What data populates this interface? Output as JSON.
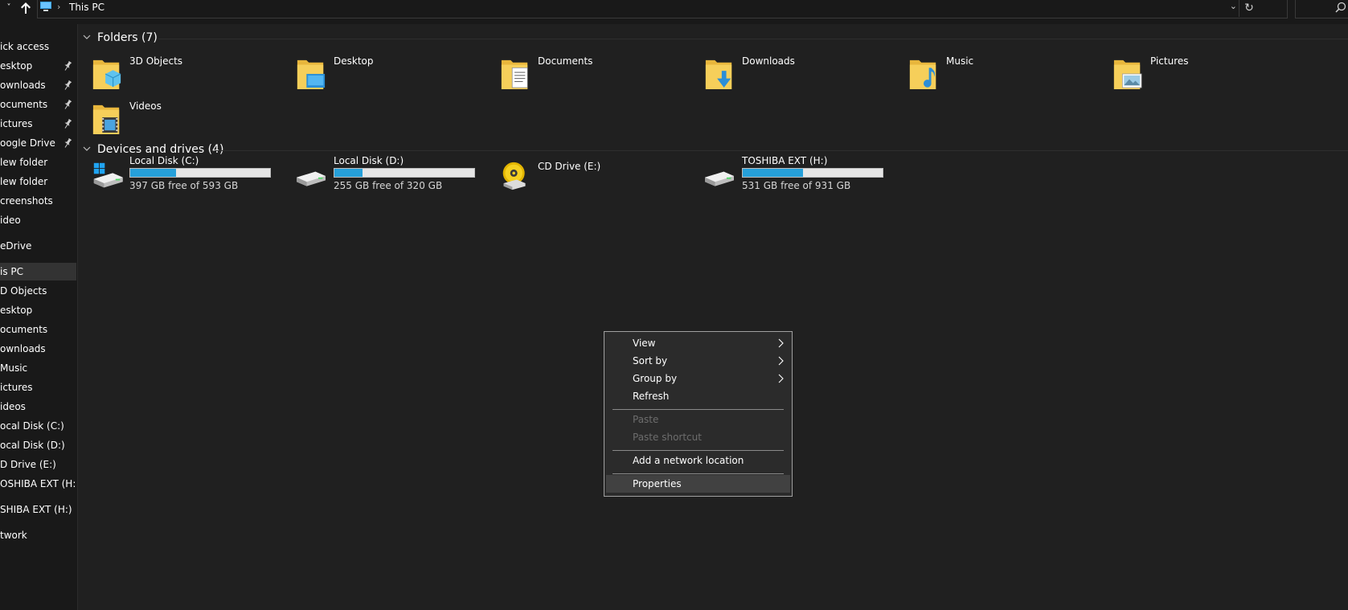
{
  "address_bar": {
    "location": "This PC",
    "back_glyph": "˅",
    "up_glyph": "🡑",
    "separator": "›",
    "dropdown_glyph": "⌄",
    "refresh_glyph": "↻"
  },
  "sidebar": {
    "items": [
      {
        "label": "ick access",
        "pinned": false
      },
      {
        "label": "esktop",
        "pinned": true
      },
      {
        "label": "ownloads",
        "pinned": true
      },
      {
        "label": "ocuments",
        "pinned": true
      },
      {
        "label": "ictures",
        "pinned": true
      },
      {
        "label": "oogle Drive",
        "pinned": true
      },
      {
        "label": "lew folder",
        "pinned": false
      },
      {
        "label": "lew folder",
        "pinned": false
      },
      {
        "label": "creenshots",
        "pinned": false
      },
      {
        "label": "ideo",
        "pinned": false
      },
      {
        "label": "eDrive",
        "pinned": false
      },
      {
        "label": "is PC",
        "pinned": false,
        "selected": true
      },
      {
        "label": "D Objects",
        "pinned": false
      },
      {
        "label": "esktop",
        "pinned": false
      },
      {
        "label": "ocuments",
        "pinned": false
      },
      {
        "label": "ownloads",
        "pinned": false
      },
      {
        "label": "Music",
        "pinned": false
      },
      {
        "label": "ictures",
        "pinned": false
      },
      {
        "label": "ideos",
        "pinned": false
      },
      {
        "label": "ocal Disk (C:)",
        "pinned": false
      },
      {
        "label": "ocal Disk (D:)",
        "pinned": false
      },
      {
        "label": "D Drive (E:)",
        "pinned": false
      },
      {
        "label": "OSHIBA EXT (H:)",
        "pinned": false
      },
      {
        "label": "SHIBA EXT (H:)",
        "pinned": false
      },
      {
        "label": "twork",
        "pinned": false
      }
    ]
  },
  "folders_group": {
    "title": "Folders (7)",
    "items": [
      {
        "label": "3D Objects",
        "icon": "3d-objects-folder-icon"
      },
      {
        "label": "Desktop",
        "icon": "desktop-folder-icon"
      },
      {
        "label": "Documents",
        "icon": "documents-folder-icon"
      },
      {
        "label": "Downloads",
        "icon": "downloads-folder-icon"
      },
      {
        "label": "Music",
        "icon": "music-folder-icon"
      },
      {
        "label": "Pictures",
        "icon": "pictures-folder-icon"
      },
      {
        "label": "Videos",
        "icon": "videos-folder-icon"
      }
    ]
  },
  "drives_group": {
    "title": "Devices and drives (4)",
    "items": [
      {
        "label": "Local Disk (C:)",
        "free": "397 GB free of 593 GB",
        "used_fraction": 0.33,
        "icon": "windows-drive-icon",
        "has_bar": true
      },
      {
        "label": "Local Disk (D:)",
        "free": "255 GB free of 320 GB",
        "used_fraction": 0.2,
        "icon": "hard-drive-icon",
        "has_bar": true
      },
      {
        "label": "CD Drive (E:)",
        "free": "",
        "used_fraction": 0,
        "icon": "cd-drive-icon",
        "has_bar": false
      },
      {
        "label": "TOSHIBA EXT (H:)",
        "free": "531 GB free of 931 GB",
        "used_fraction": 0.43,
        "icon": "hard-drive-icon",
        "has_bar": true
      }
    ]
  },
  "context_menu": {
    "view": "View",
    "sort_by": "Sort by",
    "group_by": "Group by",
    "refresh": "Refresh",
    "paste": "Paste",
    "paste_shortcut": "Paste shortcut",
    "add_network_location": "Add a network location",
    "properties": "Properties"
  },
  "colors": {
    "background": "#202020",
    "bar_fill": "#26a0da",
    "bar_track": "#e6e6e6",
    "folder": "#f3c94d"
  }
}
